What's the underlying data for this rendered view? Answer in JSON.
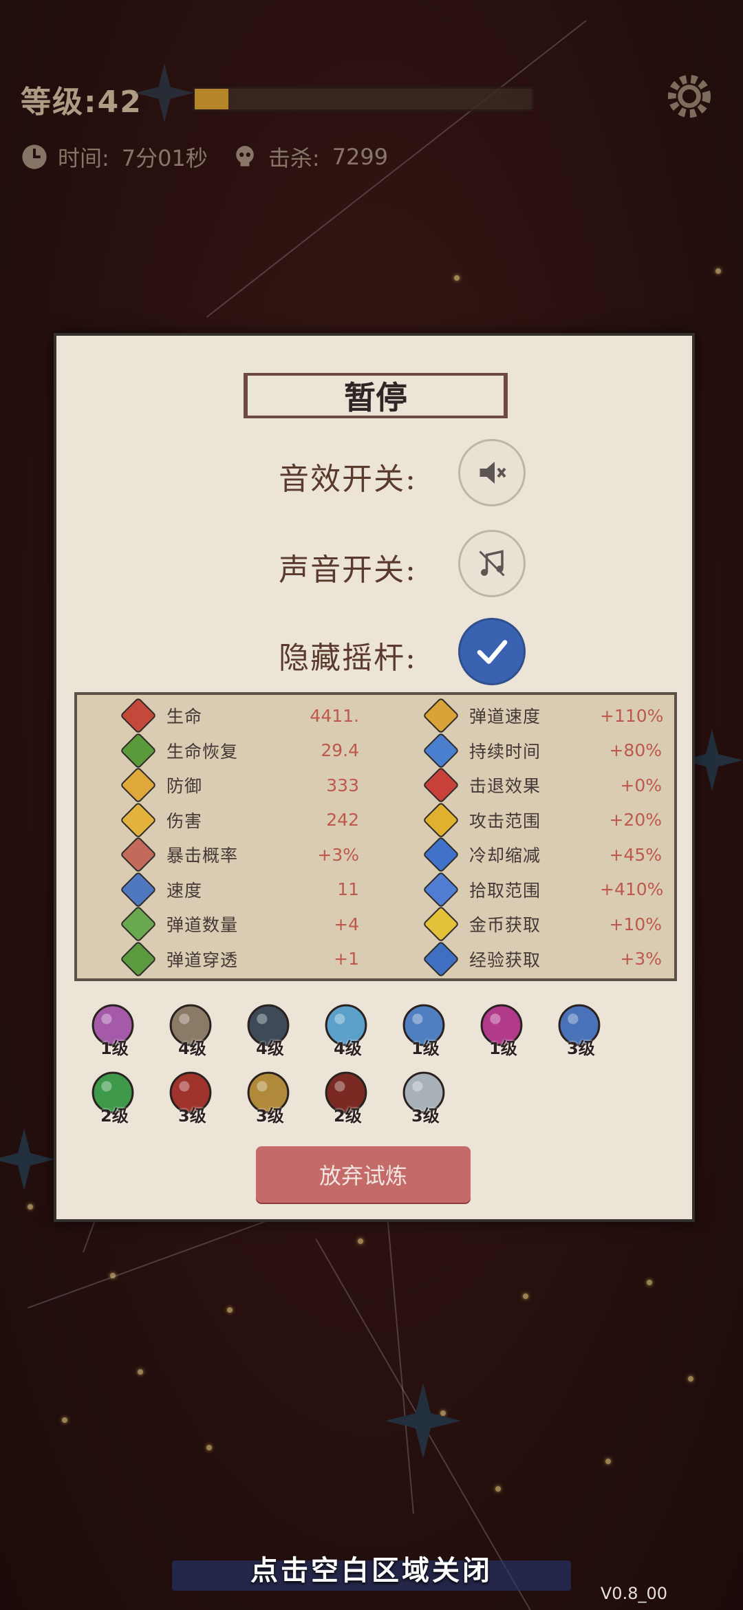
{
  "hud": {
    "level_label": "等级:42",
    "xp_progress": 0.1,
    "time_label": "时间:",
    "time_value": "7分01秒",
    "kills_label": "击杀:",
    "kills_value": "7299"
  },
  "pause": {
    "title": "暂停",
    "sfx_label": "音效开关:",
    "sound_label": "声音开关:",
    "joystick_label": "隐藏摇杆:",
    "joystick_hidden": true,
    "abandon_label": "放弃试炼"
  },
  "stats_left": [
    {
      "name": "生命",
      "value": "4411.",
      "color": "#c4493b"
    },
    {
      "name": "生命恢复",
      "value": "29.4",
      "color": "#5a9a3a"
    },
    {
      "name": "防御",
      "value": "333",
      "color": "#e0a83a"
    },
    {
      "name": "伤害",
      "value": "242",
      "color": "#e3b23c"
    },
    {
      "name": "暴击概率",
      "value": "+3%",
      "color": "#c46a5a"
    },
    {
      "name": "速度",
      "value": "11",
      "color": "#4f78c0"
    },
    {
      "name": "弹道数量",
      "value": "+4",
      "color": "#6aa84f"
    },
    {
      "name": "弹道穿透",
      "value": "+1",
      "color": "#5c9a40"
    }
  ],
  "stats_right": [
    {
      "name": "弹道速度",
      "value": "+110%",
      "color": "#d9a33a"
    },
    {
      "name": "持续时间",
      "value": "+80%",
      "color": "#4a7fd0"
    },
    {
      "name": "击退效果",
      "value": "+0%",
      "color": "#c8403a"
    },
    {
      "name": "攻击范围",
      "value": "+20%",
      "color": "#e0b12e"
    },
    {
      "name": "冷却缩减",
      "value": "+45%",
      "color": "#3f72c8"
    },
    {
      "name": "拾取范围",
      "value": "+410%",
      "color": "#4f7ed2"
    },
    {
      "name": "金币获取",
      "value": "+10%",
      "color": "#e3c23a"
    },
    {
      "name": "经验获取",
      "value": "+3%",
      "color": "#3e6fc0"
    }
  ],
  "items": [
    {
      "icon": "lotus-icon",
      "level": "1级",
      "color": "#a45aa8"
    },
    {
      "icon": "bow-icon",
      "level": "4级",
      "color": "#8a7a66"
    },
    {
      "icon": "shuriken-icon",
      "level": "4级",
      "color": "#3e4a58"
    },
    {
      "icon": "yin-yang-icon",
      "level": "4级",
      "color": "#5aa0c8"
    },
    {
      "icon": "flute-icon",
      "level": "1级",
      "color": "#4f7fc0"
    },
    {
      "icon": "potion-icon",
      "level": "1级",
      "color": "#b23a8a"
    },
    {
      "icon": "crystal-icon",
      "level": "3级",
      "color": "#4a72b8"
    },
    {
      "icon": "jade-ring-icon",
      "level": "2级",
      "color": "#3e9a4a"
    },
    {
      "icon": "dagger-icon",
      "level": "3级",
      "color": "#a0342c"
    },
    {
      "icon": "pouch-icon",
      "level": "3级",
      "color": "#b08a3a"
    },
    {
      "icon": "teapot-icon",
      "level": "2级",
      "color": "#7a2a22"
    },
    {
      "icon": "machete-icon",
      "level": "3级",
      "color": "#a8b0b8"
    }
  ],
  "footer": {
    "close_hint": "点击空白区域关闭",
    "version": "V0.8_00"
  }
}
